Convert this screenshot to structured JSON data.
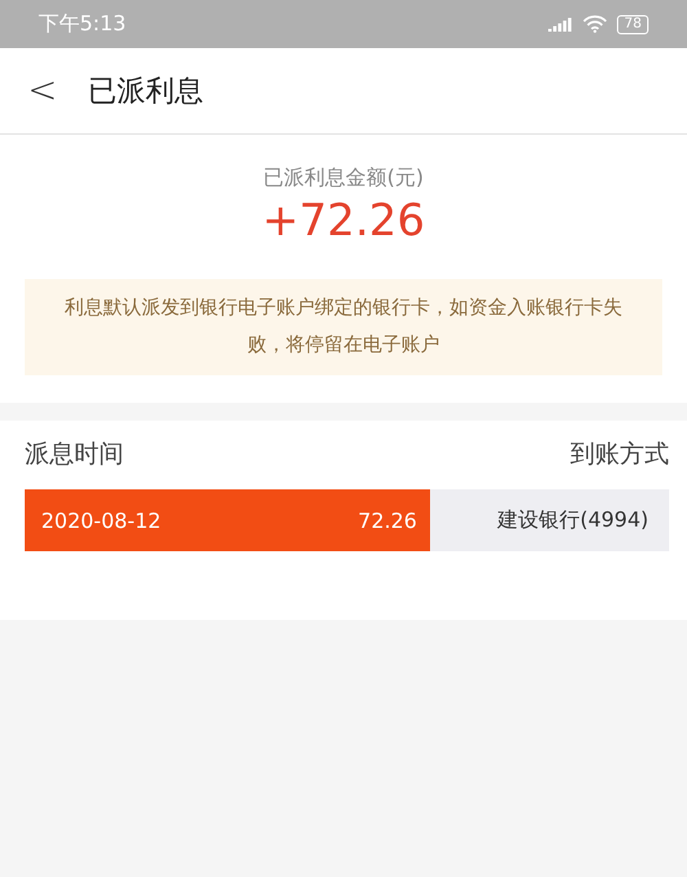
{
  "status_bar": {
    "time": "下午5:13",
    "battery": "78"
  },
  "header": {
    "back": "<",
    "title": "已派利息"
  },
  "summary": {
    "label": "已派利息金额(元)",
    "amount": "+72.26"
  },
  "notice": "利息默认派发到银行电子账户绑定的银行卡，如资金入账银行卡失败，将停留在电子账户",
  "records": {
    "columns": [
      "派息时间",
      "到账方式"
    ],
    "rows": [
      {
        "date": "2020-08-12",
        "amount": "72.26",
        "method": "建设银行(4994)",
        "level": 0.63
      }
    ]
  }
}
